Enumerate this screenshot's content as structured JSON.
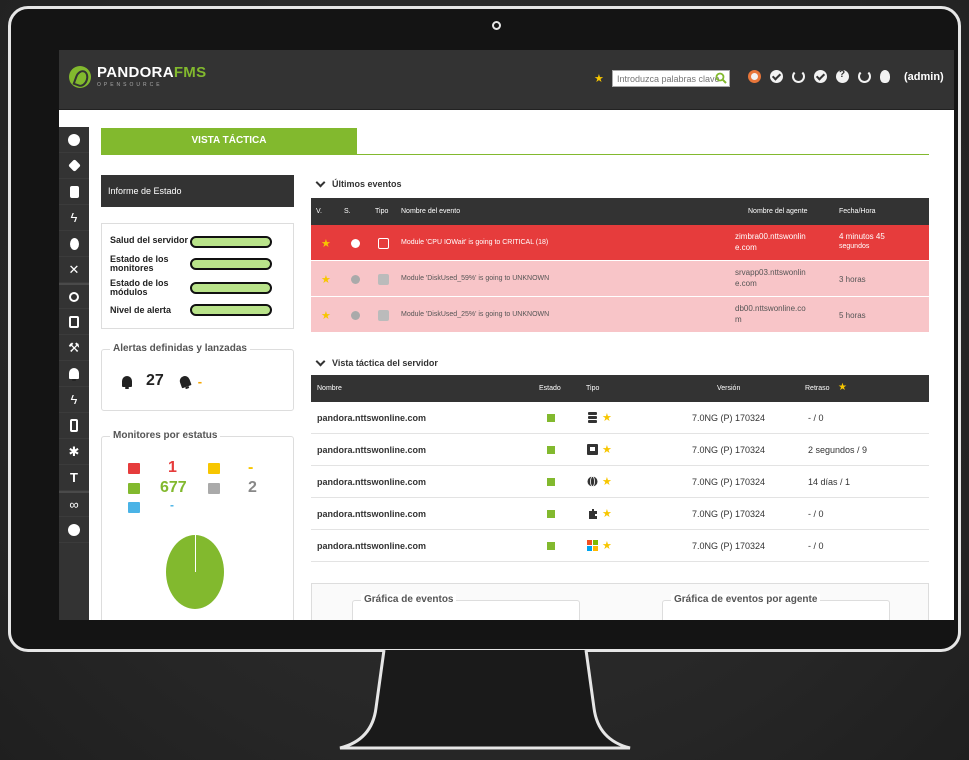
{
  "header": {
    "logo_main_1": "PANDORA",
    "logo_main_2": "FMS",
    "logo_sub": "OPENSOURCE",
    "search_placeholder": "Introduzca palabras clave",
    "user": "(admin)"
  },
  "tab": {
    "label": "VISTA TÁCTICA"
  },
  "status_report": {
    "title": "Informe de Estado",
    "rows": [
      {
        "label": "Salud del servidor"
      },
      {
        "label": "Estado de los monitores"
      },
      {
        "label": "Estado de los módulos"
      },
      {
        "label": "Nivel de alerta"
      }
    ]
  },
  "alerts": {
    "title": "Alertas definidas y lanzadas",
    "defined": "27",
    "fired": "-"
  },
  "monitors": {
    "title": "Monitores por estatus",
    "critical": "1",
    "warning": "-",
    "normal": "677",
    "unknown": "2",
    "not_init": "-",
    "colors": {
      "critical": "#e63c3c",
      "warning": "#f7c600",
      "normal": "#82b92e",
      "unknown": "#aaaaaa",
      "not_init": "#4ab3e6"
    }
  },
  "events": {
    "title": "Últimos eventos",
    "columns": [
      "V.",
      "S.",
      "Tipo",
      "Nombre del evento",
      "Nombre del agente",
      "Fecha/Hora"
    ],
    "rows": [
      {
        "name": "Module 'CPU IOWait' is going to CRITICAL (18)",
        "agent": "zimbra00.nttswonline.com",
        "agent_line1": "zimbra00.nttswonlin",
        "agent_line2": "e.com",
        "time_line1": "4 minutos 45",
        "time_line2": "segundos",
        "severity": "critical"
      },
      {
        "name": "Module 'DiskUsed_59%' is going to UNKNOWN",
        "agent_line1": "srvapp03.nttswonlin",
        "agent_line2": "e.com",
        "time_line1": "3 horas",
        "time_line2": "",
        "severity": "unknown"
      },
      {
        "name": "Module 'DiskUsed_25%' is going to UNKNOWN",
        "agent_line1": "db00.nttswonline.co",
        "agent_line2": "m",
        "time_line1": "5 horas",
        "time_line2": "",
        "severity": "unknown"
      }
    ]
  },
  "servers": {
    "title": "Vista táctica del servidor",
    "columns": [
      "Nombre",
      "Estado",
      "Tipo",
      "Versión",
      "Retraso"
    ],
    "rows": [
      {
        "name": "pandora.nttswonline.com",
        "type_icon": "database-icon",
        "version": "7.0NG (P) 170324",
        "delay": "- / 0"
      },
      {
        "name": "pandora.nttswonline.com",
        "type_icon": "network-icon",
        "version": "7.0NG (P) 170324",
        "delay": "2 segundos / 9"
      },
      {
        "name": "pandora.nttswonline.com",
        "type_icon": "globe-icon",
        "version": "7.0NG (P) 170324",
        "delay": "14 días / 1"
      },
      {
        "name": "pandora.nttswonline.com",
        "type_icon": "plugin-icon",
        "version": "7.0NG (P) 170324",
        "delay": "- / 0"
      },
      {
        "name": "pandora.nttswonline.com",
        "type_icon": "windows-icon",
        "version": "7.0NG (P) 170324",
        "delay": "- / 0"
      }
    ]
  },
  "graphs": {
    "events": "Gráfica de eventos",
    "events_by_agent": "Gráfica de eventos por agente"
  }
}
